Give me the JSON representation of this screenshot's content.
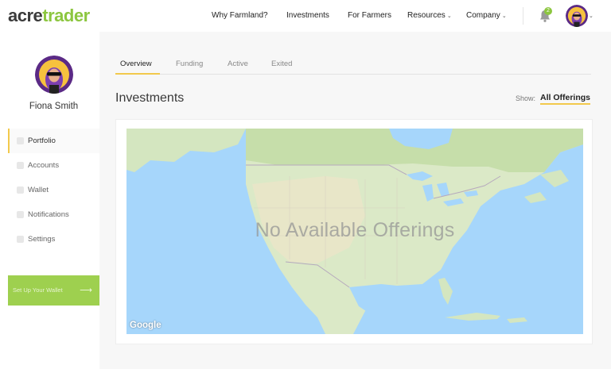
{
  "brand": {
    "part1": "acre",
    "part2": "trader"
  },
  "nav": {
    "items": [
      {
        "label": "Why Farmland?",
        "dropdown": false
      },
      {
        "label": "Investments",
        "dropdown": false
      },
      {
        "label": "For Farmers",
        "dropdown": false
      },
      {
        "label": "Resources",
        "dropdown": true
      },
      {
        "label": "Company",
        "dropdown": true
      }
    ],
    "notification_count": "2",
    "notification_icon": "bell-icon"
  },
  "user": {
    "name": "Fiona Smith"
  },
  "sidebar": {
    "items": [
      {
        "label": "Portfolio",
        "icon": "user-icon",
        "active": true
      },
      {
        "label": "Accounts",
        "icon": "user-icon",
        "active": false
      },
      {
        "label": "Wallet",
        "icon": "wallet-icon",
        "active": false
      },
      {
        "label": "Notifications",
        "icon": "bell-icon",
        "active": false
      },
      {
        "label": "Settings",
        "icon": "gear-icon",
        "active": false
      }
    ],
    "wallet_button": "Set Up Your Wallet",
    "wallet_arrow": "⟶"
  },
  "tabs": [
    {
      "label": "Overview",
      "active": true
    },
    {
      "label": "Funding",
      "active": false
    },
    {
      "label": "Active",
      "active": false
    },
    {
      "label": "Exited",
      "active": false
    }
  ],
  "investments": {
    "title": "Investments",
    "show_label": "Show:",
    "show_value": "All Offerings",
    "empty_message": "No Available Offerings",
    "map_attribution": "Google"
  },
  "colors": {
    "brand_green": "#8cc63f",
    "accent_yellow": "#f2c94c",
    "wallet_button": "#9ed04f",
    "water": "#a6d6fb",
    "land": "#d8e7c4"
  }
}
